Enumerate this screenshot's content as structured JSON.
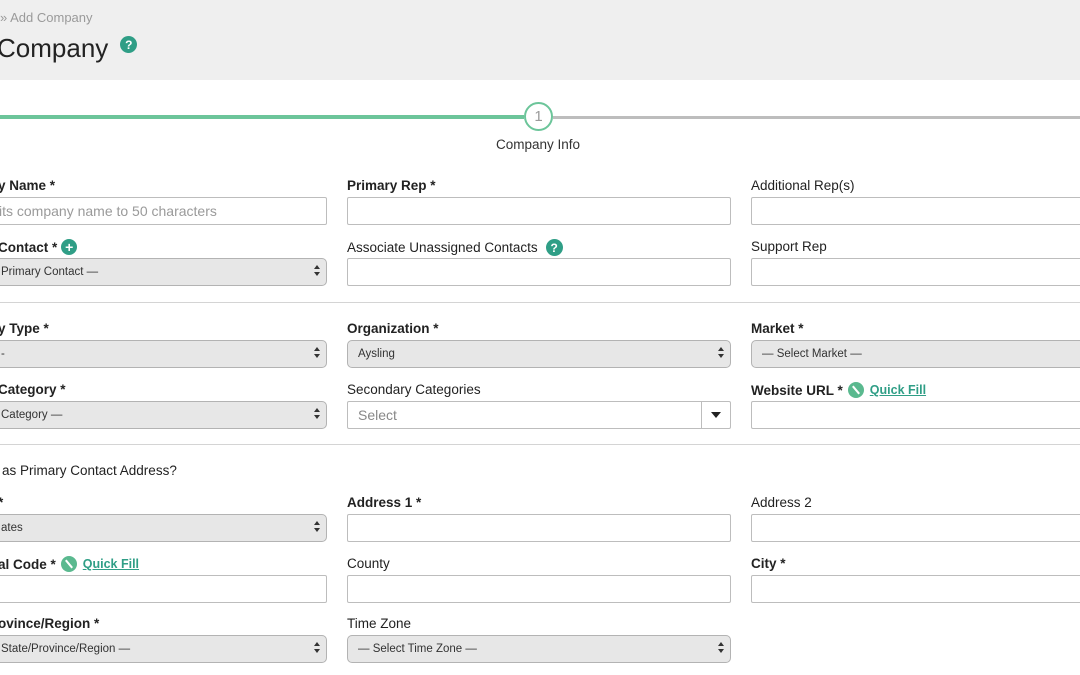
{
  "header": {
    "breadcrumb": "» Add Company",
    "title": "Company"
  },
  "stepper": {
    "step_number": "1",
    "step_label": "Company Info"
  },
  "form": {
    "company_name": {
      "label": "y Name *",
      "placeholder": "its company name to 50 characters"
    },
    "primary_rep": {
      "label": "Primary Rep *",
      "value": ""
    },
    "additional_reps": {
      "label": "Additional Rep(s)",
      "value": ""
    },
    "primary_contact": {
      "label": "Contact *",
      "selected": "Primary Contact —"
    },
    "associate_contacts": {
      "label": "Associate Unassigned Contacts",
      "value": ""
    },
    "support_rep": {
      "label": "Support Rep",
      "value": ""
    },
    "company_type": {
      "label": "y Type *",
      "selected": "-"
    },
    "organization": {
      "label": "Organization *",
      "selected": "Aysling"
    },
    "market": {
      "label": "Market *",
      "selected": "— Select Market —"
    },
    "category": {
      "label": "Category *",
      "selected": "Category —"
    },
    "secondary_categories": {
      "label": "Secondary Categories",
      "placeholder": "Select"
    },
    "website_url": {
      "label": "Website URL *",
      "quick_fill": "Quick Fill",
      "value": ""
    },
    "same_address": {
      "label": "as Primary Contact Address?"
    },
    "country": {
      "label": "*",
      "selected": "ates"
    },
    "address1": {
      "label": "Address 1 *",
      "value": ""
    },
    "address2": {
      "label": "Address 2",
      "value": ""
    },
    "postal_code": {
      "label": "al Code *",
      "quick_fill": "Quick Fill",
      "value": ""
    },
    "county": {
      "label": "County",
      "value": ""
    },
    "city": {
      "label": "City *",
      "value": ""
    },
    "state": {
      "label": "ovince/Region *",
      "selected": "State/Province/Region —"
    },
    "time_zone": {
      "label": "Time Zone",
      "selected": "— Select Time Zone —"
    }
  },
  "icons": {
    "help": "?",
    "plus": "+"
  },
  "colors": {
    "accent": "#2f9e86",
    "step_done": "#6cc59a",
    "step_todo": "#bdbdbd",
    "header_bg": "#efefef"
  }
}
